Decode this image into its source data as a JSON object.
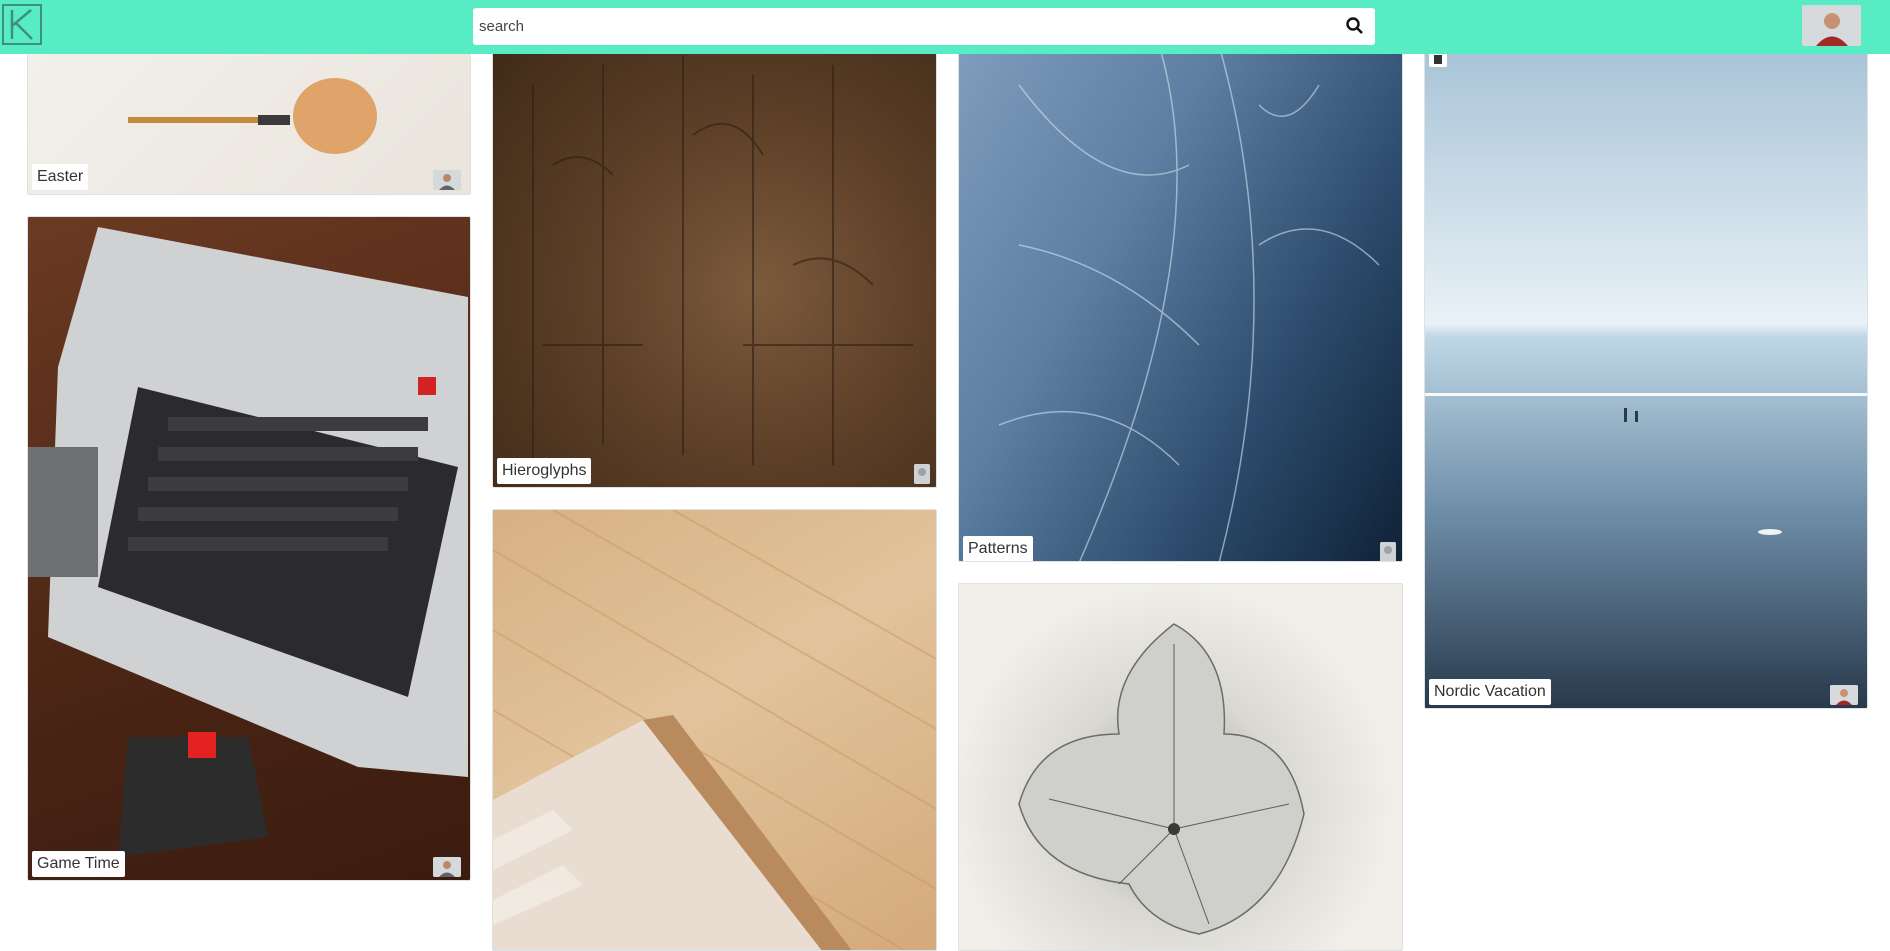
{
  "header": {
    "logo_icon": "k-logo-icon",
    "search": {
      "placeholder": "search",
      "value": ""
    },
    "search_icon": "search-icon",
    "avatar_icon": "user-avatar"
  },
  "cards": [
    {
      "id": "easter",
      "title": "Easter"
    },
    {
      "id": "game-time",
      "title": "Game Time"
    },
    {
      "id": "hieroglyphs",
      "title": "Hieroglyphs"
    },
    {
      "id": "rug",
      "title": ""
    },
    {
      "id": "patterns",
      "title": "Patterns"
    },
    {
      "id": "leaf",
      "title": ""
    },
    {
      "id": "nordic-vacation",
      "title": "Nordic Vacation",
      "has_trash_icon": true
    }
  ],
  "colors": {
    "header": "#58ecc4",
    "label_bg": "#ffffff"
  }
}
